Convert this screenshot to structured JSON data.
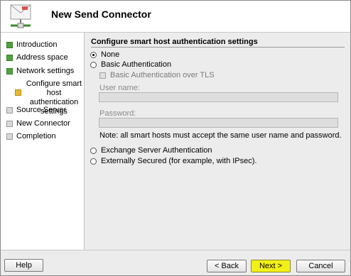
{
  "header": {
    "title": "New Send Connector"
  },
  "sidebar": {
    "items": [
      {
        "label": "Introduction",
        "status": "complete"
      },
      {
        "label": "Address space",
        "status": "complete"
      },
      {
        "label": "Network settings",
        "status": "complete"
      },
      {
        "label": "Configure smart host authentication settings",
        "lines": [
          "Configure smart",
          "host authentication",
          "settings"
        ],
        "status": "current"
      },
      {
        "label": "Source Server",
        "status": "pending"
      },
      {
        "label": "New Connector",
        "status": "pending"
      },
      {
        "label": "Completion",
        "status": "pending"
      }
    ]
  },
  "main": {
    "section_title": "Configure smart host authentication settings",
    "options": {
      "none": {
        "label": "None",
        "selected": true
      },
      "basic": {
        "label": "Basic Authentication",
        "selected": false
      },
      "basic_tls": {
        "label": "Basic Authentication over TLS",
        "checked": false,
        "enabled": false
      },
      "exchange": {
        "label": "Exchange Server Authentication",
        "selected": false
      },
      "external": {
        "label": "Externally Secured (for example, with IPsec).",
        "selected": false
      }
    },
    "user_name": {
      "label": "User name:",
      "value": ""
    },
    "password": {
      "label": "Password:",
      "value": ""
    },
    "note": "Note: all smart hosts must accept the same user name and password."
  },
  "footer": {
    "help": "Help",
    "back": "< Back",
    "next": "Next >",
    "cancel": "Cancel"
  },
  "colors": {
    "complete": "#4ea33a",
    "current": "#e7b92e",
    "pending": "#d8d8d8",
    "next_highlight": "#f3f018"
  }
}
